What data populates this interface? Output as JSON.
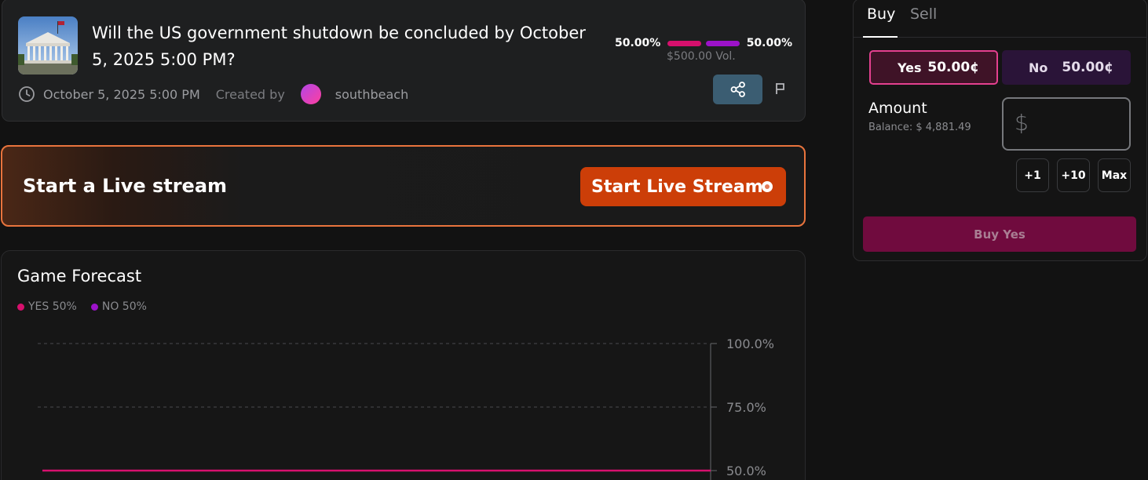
{
  "market": {
    "question": "Will the US government shutdown be concluded by October 5, 2025 5:00 PM?",
    "yes_pct": "50.00%",
    "no_pct": "50.00%",
    "volume": "$500.00 Vol.",
    "end_date": "October 5, 2025 5:00 PM",
    "created_by_label": "Created by",
    "creator": "southbeach"
  },
  "live": {
    "title": "Start a Live stream",
    "button_label": "Start Live Stream"
  },
  "forecast": {
    "title": "Game Forecast",
    "legend": [
      {
        "label": "YES 50%",
        "color": "#d6106d"
      },
      {
        "label": "NO 50%",
        "color": "#9c12c9"
      }
    ]
  },
  "chart_data": {
    "type": "line",
    "title": "Game Forecast",
    "y_ticks": [
      "100.0%",
      "75.0%",
      "50.0%"
    ],
    "ylim": [
      50,
      100
    ],
    "grid": true,
    "legend_position": "top-left",
    "series": [
      {
        "name": "YES 50%",
        "values": [
          50,
          50
        ],
        "color": "#d6106d"
      }
    ]
  },
  "trade": {
    "tabs": [
      "Buy",
      "Sell"
    ],
    "active_tab": "Buy",
    "yes_label": "Yes",
    "yes_price": "50.00¢",
    "no_label": "No",
    "no_price": "50.00¢",
    "amount_label": "Amount",
    "balance": "Balance: $ 4,881.49",
    "currency_symbol": "$",
    "amount_value": "",
    "quick_amounts": [
      "+1",
      "+10",
      "Max"
    ],
    "submit_label": "Buy Yes"
  },
  "icons": {
    "clock": "clock-icon",
    "share": "share-icon",
    "flag": "flag-icon",
    "live": "live-record-icon"
  },
  "colors": {
    "yes": "#d6106d",
    "no": "#9c12c9",
    "live_accent": "#cc3e08",
    "share_button": "#3b5d72"
  }
}
